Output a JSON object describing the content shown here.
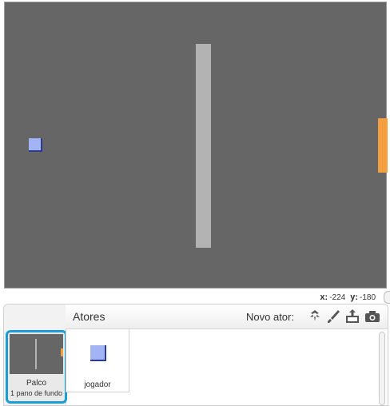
{
  "coords": {
    "x_label": "x:",
    "x_value": "-224",
    "y_label": "y:",
    "y_value": "-180"
  },
  "sprites_header": {
    "title": "Atores",
    "new_sprite_label": "Novo ator:"
  },
  "toolbar_icons": [
    "sprite-library-icon",
    "paint-brush-icon",
    "upload-icon",
    "camera-icon"
  ],
  "stage_item": {
    "name": "Palco",
    "subtitle": "1 pano de fundo"
  },
  "sprites": [
    {
      "name": "jogador"
    }
  ],
  "colors": {
    "stage_bg": "#666666",
    "wall": "#b3b3b3",
    "player": "#a3b4f5",
    "accent_orange": "#f4a040",
    "selection": "#1d9dd8"
  }
}
